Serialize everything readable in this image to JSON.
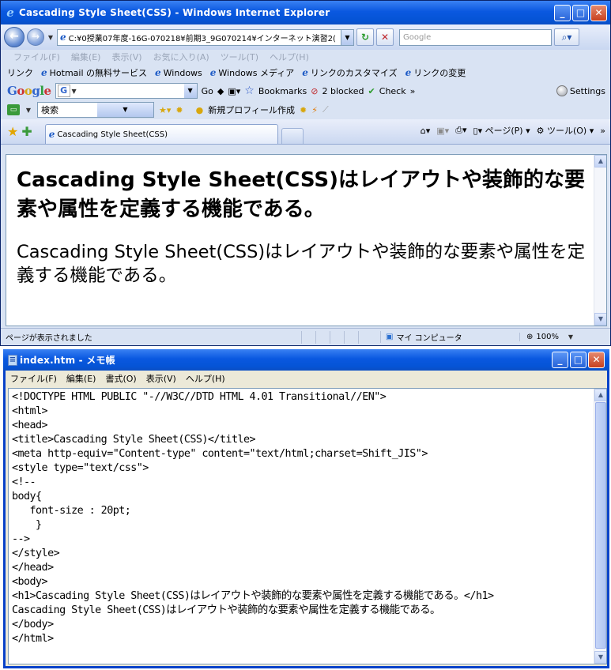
{
  "ie": {
    "title": "Cascading Style Sheet(CSS) - Windows Internet Explorer",
    "address": "C:¥0授業07年度-16G-070218¥前期3_9G070214¥インターネット演習2(",
    "search_placeholder": "Google",
    "menu": [
      "ファイル(F)",
      "編集(E)",
      "表示(V)",
      "お気に入り(A)",
      "ツール(T)",
      "ヘルプ(H)"
    ],
    "links_label": "リンク",
    "links": [
      "Hotmail の無料サービス",
      "Windows",
      "Windows メディア",
      "リンクのカスタマイズ",
      "リンクの変更"
    ],
    "google": {
      "go": "Go",
      "bookmarks": "Bookmarks",
      "blocked": "2 blocked",
      "check": "Check",
      "settings": "Settings"
    },
    "search_combo": "検索",
    "new_profile": "新規プロフィール作成",
    "tab_title": "Cascading Style Sheet(CSS)",
    "commands": {
      "page": "ページ(P)",
      "tools": "ツール(O)"
    },
    "content": {
      "h1": "Cascading Style Sheet(CSS)はレイアウトや装飾的な要素や属性を定義する機能である。",
      "p": "Cascading Style Sheet(CSS)はレイアウトや装飾的な要素や属性を定義する機能である。"
    },
    "status": {
      "text": "ページが表示されました",
      "zone": "マイ コンピュータ",
      "zoom": "100%"
    }
  },
  "notepad": {
    "title": "index.htm - メモ帳",
    "menu": [
      "ファイル(F)",
      "編集(E)",
      "書式(O)",
      "表示(V)",
      "ヘルプ(H)"
    ],
    "code_lines": [
      "<!DOCTYPE HTML PUBLIC \"-//W3C//DTD HTML 4.01 Transitional//EN\">",
      "<html>",
      "<head>",
      "<title>Cascading Style Sheet(CSS)</title>",
      "<meta http-equiv=\"Content-type\" content=\"text/html;charset=Shift_JIS\">",
      "<style type=\"text/css\">",
      "<!--",
      "body{",
      "   font-size : 20pt;",
      "    }",
      "-->",
      "</style>",
      "</head>",
      "<body>",
      "<h1>Cascading Style Sheet(CSS)はレイアウトや装飾的な要素や属性を定義する機能である。</h1>",
      "Cascading Style Sheet(CSS)はレイアウトや装飾的な要素や属性を定義する機能である。",
      "</body>",
      "</html>"
    ]
  },
  "colors": {
    "titlebar": "#0554d6",
    "chrome": "#d9e3f3",
    "notepad_frame": "#0842c9"
  }
}
